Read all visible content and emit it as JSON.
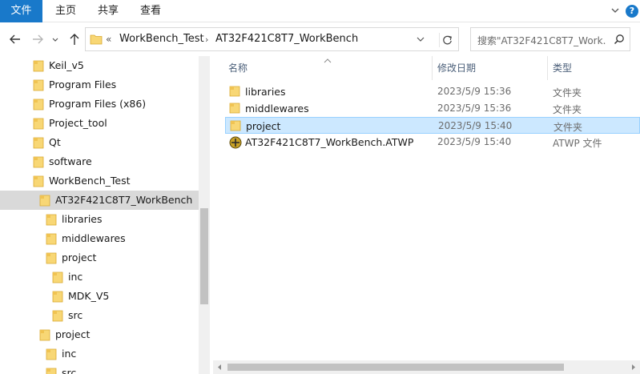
{
  "ribbon": {
    "tabs": [
      "文件",
      "主页",
      "共享",
      "查看"
    ],
    "help_label": "?"
  },
  "address": {
    "overflow": "«",
    "crumbs": [
      "WorkBench_Test",
      "AT32F421C8T7_WorkBench"
    ],
    "separator": "›"
  },
  "search": {
    "placeholder": "搜索\"AT32F421C8T7_Work..."
  },
  "nav_tree": [
    {
      "label": "Keil_v5"
    },
    {
      "label": "Program Files"
    },
    {
      "label": "Program Files (x86)"
    },
    {
      "label": "Project_tool"
    },
    {
      "label": "Qt"
    },
    {
      "label": "software"
    },
    {
      "label": "WorkBench_Test"
    },
    {
      "label": "AT32F421C8T7_WorkBench",
      "selected": true
    },
    {
      "label": "libraries"
    },
    {
      "label": "middlewares"
    },
    {
      "label": "project"
    },
    {
      "label": "inc"
    },
    {
      "label": "MDK_V5"
    },
    {
      "label": "src"
    },
    {
      "label": "project"
    },
    {
      "label": "inc"
    },
    {
      "label": "src"
    }
  ],
  "columns": {
    "name": "名称",
    "date": "修改日期",
    "type": "类型"
  },
  "files": [
    {
      "name": "libraries",
      "date": "2023/5/9 15:36",
      "type": "文件夹",
      "icon": "folder-icon"
    },
    {
      "name": "middlewares",
      "date": "2023/5/9 15:36",
      "type": "文件夹",
      "icon": "folder-icon"
    },
    {
      "name": "project",
      "date": "2023/5/9 15:40",
      "type": "文件夹",
      "icon": "folder-icon",
      "selected": true
    },
    {
      "name": "AT32F421C8T7_WorkBench.ATWP",
      "date": "2023/5/9 15:40",
      "type": "ATWP 文件",
      "icon": "atwp-file-icon"
    }
  ],
  "colors": {
    "accent": "#1979ca",
    "selection": "#cce8ff",
    "folder": "#f8d775"
  }
}
